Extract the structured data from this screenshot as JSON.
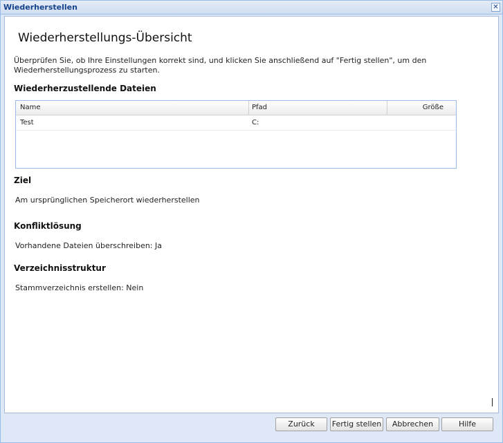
{
  "window": {
    "title": "Wiederherstellen"
  },
  "page": {
    "heading": "Wiederherstellungs-Übersicht",
    "description": "Überprüfen Sie, ob Ihre Einstellungen korrekt sind, und klicken Sie anschließend auf \"Fertig stellen\", um den Wiederherstellungsprozess zu starten."
  },
  "files": {
    "section_title": "Wiederherzustellende Dateien",
    "columns": [
      "Name",
      "Pfad",
      "Größe"
    ],
    "rows": [
      {
        "name": "Test",
        "path": "C:",
        "size": ""
      }
    ]
  },
  "target": {
    "section_title": "Ziel",
    "value": "Am ursprünglichen Speicherort wiederherstellen"
  },
  "conflict": {
    "section_title": "Konfliktlösung",
    "value": "Vorhandene Dateien überschreiben: Ja"
  },
  "structure": {
    "section_title": "Verzeichnisstruktur",
    "value": "Stammverzeichnis erstellen: Nein"
  },
  "footer": {
    "back": "Zurück",
    "finish": "Fertig stellen",
    "cancel": "Abbrechen",
    "help": "Hilfe"
  },
  "icons": {
    "close": "close-icon"
  }
}
